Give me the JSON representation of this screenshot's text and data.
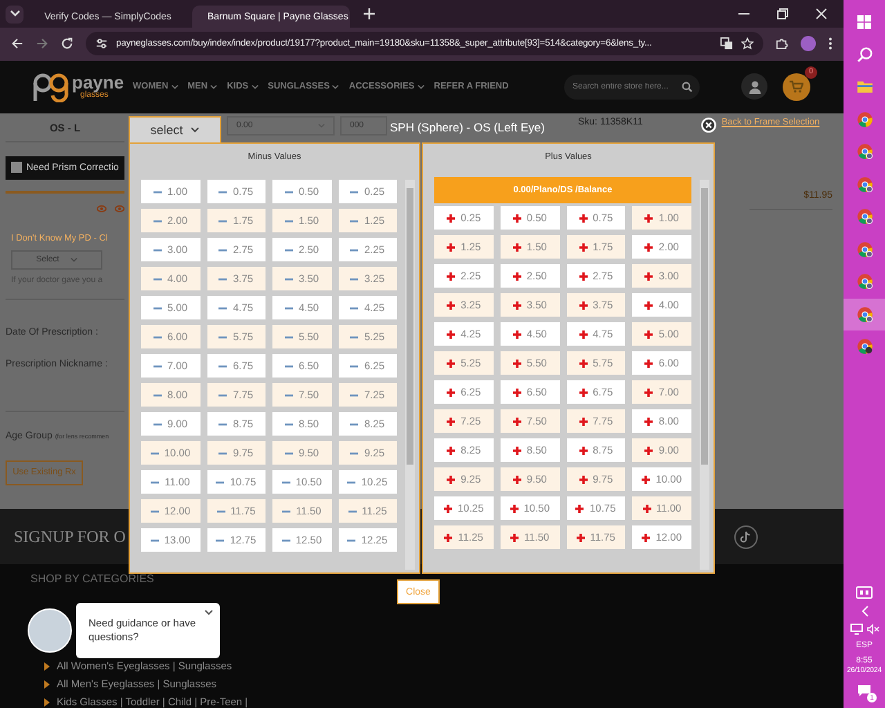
{
  "browser": {
    "tabs": [
      {
        "title": "Verify Codes — SimplyCodes",
        "selected": false
      },
      {
        "title": "Barnum Square | Payne Glasses",
        "selected": true
      }
    ],
    "url": "payneglasses.com/buy/index/index/product/19177?product_main=19180&sku=11358&_super_attribute[93]=514&category=6&lens_ty..."
  },
  "site_header": {
    "logo": {
      "word": "payne",
      "tagline": "glasses"
    },
    "nav": [
      {
        "label": "WOMEN",
        "has_menu": true
      },
      {
        "label": "MEN",
        "has_menu": true
      },
      {
        "label": "KIDS",
        "has_menu": true
      },
      {
        "label": "SUNGLASSES",
        "has_menu": true
      },
      {
        "label": "ACCESSORIES",
        "has_menu": true
      },
      {
        "label": "REFER A FRIEND",
        "has_menu": false
      }
    ],
    "search": {
      "placeholder": "Search entire store here..."
    },
    "cart_count": "0"
  },
  "prescription_form": {
    "eye_label": "OS - L",
    "cyl_value": "0.00",
    "axis_value": "000",
    "prism": {
      "label": "Need Prism Correctio",
      "checked": false
    },
    "pd_link": "I Don't Know My PD - Cl",
    "pd_select": "Select",
    "pd_hint": "If your doctor gave you a",
    "date_label": "Date Of Prescription :",
    "nickname_label": "Prescription Nickname :",
    "age_group": {
      "label": "Age Group",
      "note": "(for lens recommen"
    },
    "use_existing_button": "Use Existing Rx"
  },
  "product_info": {
    "sku": "Sku: 11358K11",
    "back_link": "Back to Frame Selection",
    "price": "$11.95"
  },
  "sph_picker": {
    "select_button": "select",
    "title": "SPH (Sphere) - OS (Left Eye)",
    "minus": {
      "heading": "Minus Values",
      "values": [
        {
          "label": "1.00",
          "selected": false
        },
        {
          "label": "0.75",
          "selected": false
        },
        {
          "label": "0.50",
          "selected": false
        },
        {
          "label": "0.25",
          "selected": false
        },
        {
          "label": "2.00",
          "selected": false
        },
        {
          "label": "1.75",
          "selected": false
        },
        {
          "label": "1.50",
          "selected": false
        },
        {
          "label": "1.25",
          "selected": false
        },
        {
          "label": "3.00",
          "selected": false
        },
        {
          "label": "2.75",
          "selected": false
        },
        {
          "label": "2.50",
          "selected": false
        },
        {
          "label": "2.25",
          "selected": false
        },
        {
          "label": "4.00",
          "selected": false
        },
        {
          "label": "3.75",
          "selected": false
        },
        {
          "label": "3.50",
          "selected": false
        },
        {
          "label": "3.25",
          "selected": false
        },
        {
          "label": "5.00",
          "selected": false
        },
        {
          "label": "4.75",
          "selected": false
        },
        {
          "label": "4.50",
          "selected": false
        },
        {
          "label": "4.25",
          "selected": false
        },
        {
          "label": "6.00",
          "selected": false
        },
        {
          "label": "5.75",
          "selected": false
        },
        {
          "label": "5.50",
          "selected": false
        },
        {
          "label": "5.25",
          "selected": false
        },
        {
          "label": "7.00",
          "selected": false
        },
        {
          "label": "6.75",
          "selected": false
        },
        {
          "label": "6.50",
          "selected": false
        },
        {
          "label": "6.25",
          "selected": false
        },
        {
          "label": "8.00",
          "selected": false
        },
        {
          "label": "7.75",
          "selected": false
        },
        {
          "label": "7.50",
          "selected": false
        },
        {
          "label": "7.25",
          "selected": false
        },
        {
          "label": "9.00",
          "selected": false
        },
        {
          "label": "8.75",
          "selected": false
        },
        {
          "label": "8.50",
          "selected": false
        },
        {
          "label": "8.25",
          "selected": false
        },
        {
          "label": "10.00",
          "selected": false
        },
        {
          "label": "9.75",
          "selected": false
        },
        {
          "label": "9.50",
          "selected": false
        },
        {
          "label": "9.25",
          "selected": false
        },
        {
          "label": "11.00",
          "selected": false
        },
        {
          "label": "10.75",
          "selected": false
        },
        {
          "label": "10.50",
          "selected": false
        },
        {
          "label": "10.25",
          "selected": false
        },
        {
          "label": "12.00",
          "selected": false
        },
        {
          "label": "11.75",
          "selected": false
        },
        {
          "label": "11.50",
          "selected": false
        },
        {
          "label": "11.25",
          "selected": false
        },
        {
          "label": "13.00",
          "selected": false
        },
        {
          "label": "12.75",
          "selected": false
        },
        {
          "label": "12.50",
          "selected": false
        },
        {
          "label": "12.25",
          "selected": false
        }
      ]
    },
    "plus": {
      "heading": "Plus Values",
      "balance": {
        "label": "0.00/Plano/DS /Balance",
        "selected": true
      },
      "values": [
        {
          "label": "0.25",
          "selected": false
        },
        {
          "label": "0.50",
          "selected": false
        },
        {
          "label": "0.75",
          "selected": false
        },
        {
          "label": "1.00",
          "selected": false
        },
        {
          "label": "1.25",
          "selected": false
        },
        {
          "label": "1.50",
          "selected": false
        },
        {
          "label": "1.75",
          "selected": false
        },
        {
          "label": "2.00",
          "selected": false
        },
        {
          "label": "2.25",
          "selected": false
        },
        {
          "label": "2.50",
          "selected": false
        },
        {
          "label": "2.75",
          "selected": false
        },
        {
          "label": "3.00",
          "selected": false
        },
        {
          "label": "3.25",
          "selected": false
        },
        {
          "label": "3.50",
          "selected": false
        },
        {
          "label": "3.75",
          "selected": false
        },
        {
          "label": "4.00",
          "selected": false
        },
        {
          "label": "4.25",
          "selected": false
        },
        {
          "label": "4.50",
          "selected": false
        },
        {
          "label": "4.75",
          "selected": false
        },
        {
          "label": "5.00",
          "selected": false
        },
        {
          "label": "5.25",
          "selected": false
        },
        {
          "label": "5.50",
          "selected": false
        },
        {
          "label": "5.75",
          "selected": false
        },
        {
          "label": "6.00",
          "selected": false
        },
        {
          "label": "6.25",
          "selected": false
        },
        {
          "label": "6.50",
          "selected": false
        },
        {
          "label": "6.75",
          "selected": false
        },
        {
          "label": "7.00",
          "selected": false
        },
        {
          "label": "7.25",
          "selected": false
        },
        {
          "label": "7.50",
          "selected": false
        },
        {
          "label": "7.75",
          "selected": false
        },
        {
          "label": "8.00",
          "selected": false
        },
        {
          "label": "8.25",
          "selected": false
        },
        {
          "label": "8.50",
          "selected": false
        },
        {
          "label": "8.75",
          "selected": false
        },
        {
          "label": "9.00",
          "selected": false
        },
        {
          "label": "9.25",
          "selected": false
        },
        {
          "label": "9.50",
          "selected": false
        },
        {
          "label": "9.75",
          "selected": false
        },
        {
          "label": "10.00",
          "selected": false
        },
        {
          "label": "10.25",
          "selected": false
        },
        {
          "label": "10.50",
          "selected": false
        },
        {
          "label": "10.75",
          "selected": false
        },
        {
          "label": "11.00",
          "selected": false
        },
        {
          "label": "11.25",
          "selected": false
        },
        {
          "label": "11.50",
          "selected": false
        },
        {
          "label": "11.75",
          "selected": false
        },
        {
          "label": "12.00",
          "selected": false
        }
      ]
    },
    "close_button": "Close"
  },
  "signup": {
    "heading": "SIGNUP FOR O"
  },
  "footer": {
    "heading": "SHOP BY CATEGORIES",
    "links": [
      "All Women's Eyeglasses | Sunglasses",
      "All Men's Eyeglasses | Sunglasses",
      "Kids Glasses | Toddler | Child | Pre-Teen |"
    ]
  },
  "chat": {
    "message": "Need guidance or have questions?"
  },
  "taskbar": {
    "apps": [
      {
        "kind": "start",
        "selected": false
      },
      {
        "kind": "search",
        "selected": false
      },
      {
        "kind": "files",
        "selected": false
      },
      {
        "kind": "browser",
        "selected": false
      },
      {
        "kind": "browser-profile",
        "selected": false
      },
      {
        "kind": "browser-profile",
        "selected": false
      },
      {
        "kind": "browser-profile",
        "selected": false
      },
      {
        "kind": "browser-profile",
        "selected": false
      },
      {
        "kind": "browser-profile",
        "selected": false
      },
      {
        "kind": "browser-profile",
        "selected": true
      },
      {
        "kind": "browser-alt",
        "selected": false
      }
    ],
    "language": "ESP",
    "time": "8:55",
    "date": "26/10/2024",
    "notifications": "1"
  }
}
